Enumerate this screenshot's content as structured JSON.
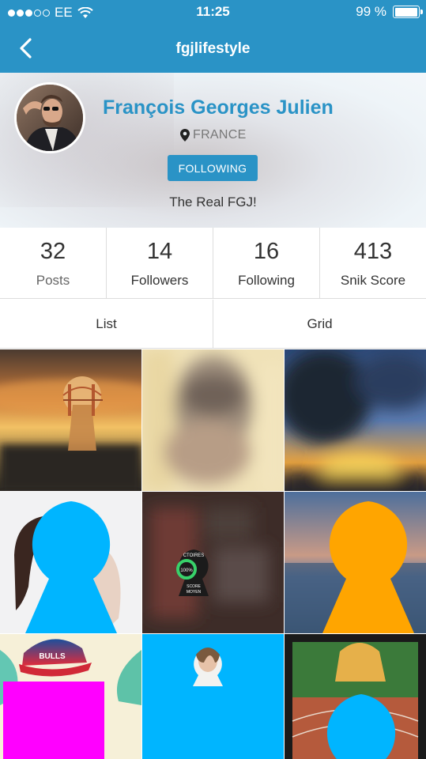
{
  "status_bar": {
    "carrier": "EE",
    "signal_bars": 5,
    "signal_filled": 3,
    "time": "11:25",
    "battery": "99 %",
    "battery_level": 0.99
  },
  "navbar": {
    "title": "fgjlifestyle",
    "back_icon": "chevron-left-icon"
  },
  "profile": {
    "name": "François Georges Julien",
    "location": "FRANCE",
    "location_icon": "map-pin-icon",
    "follow_button": "FOLLOWING",
    "bio": "The Real FGJ!"
  },
  "stats": [
    {
      "value": "32",
      "label": "Posts"
    },
    {
      "value": "14",
      "label": "Followers"
    },
    {
      "value": "16",
      "label": "Following"
    },
    {
      "value": "413",
      "label": "Snik Score"
    }
  ],
  "tabs": [
    {
      "label": "List"
    },
    {
      "label": "Grid"
    }
  ],
  "grid_items": [
    {
      "kind": "blurred-photo",
      "desc": "golden-gate-sunset"
    },
    {
      "kind": "blurred-photo",
      "desc": "portrait"
    },
    {
      "kind": "blurred-photo",
      "desc": "sunset-sky"
    },
    {
      "kind": "keyhole-post",
      "color": "#00b5ff"
    },
    {
      "kind": "keyhole-post",
      "desc": "score-moyen"
    },
    {
      "kind": "keyhole-post",
      "color": "#ffa500"
    },
    {
      "kind": "photo",
      "desc": "bulls-cap",
      "color": "#ff00ff"
    },
    {
      "kind": "photo",
      "color": "#00b5ff"
    },
    {
      "kind": "keyhole-post",
      "color": "#00b5ff"
    }
  ],
  "colors": {
    "brand": "#2a93c6",
    "keyhole_blue": "#00b5ff",
    "keyhole_orange": "#ffa500",
    "magenta": "#ff00ff"
  },
  "keyhole_texts": {
    "top": "CTOIRES",
    "pct": "100%",
    "bottom1": "SCORE",
    "bottom2": "MOYEN",
    "cap": "BULLS"
  }
}
